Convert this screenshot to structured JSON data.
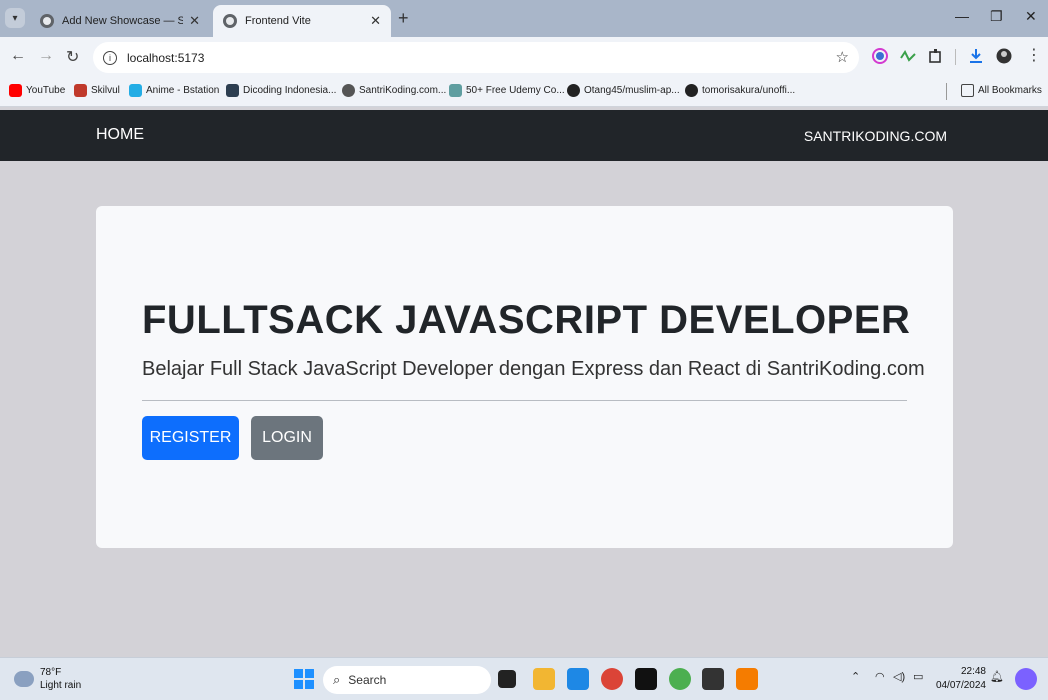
{
  "browser": {
    "tabs": [
      {
        "title": "Add New Showcase — SantriKo",
        "active": false
      },
      {
        "title": "Frontend Vite",
        "active": true
      }
    ],
    "address": "localhost:5173",
    "bookmarks": [
      {
        "label": "YouTube",
        "icon": "youtube-icon",
        "color": "#ff0000"
      },
      {
        "label": "Skilvul",
        "icon": "skilvul-icon",
        "color": "#c0392b"
      },
      {
        "label": "Anime - Bstation",
        "icon": "bstation-icon",
        "color": "#23ade5"
      },
      {
        "label": "Dicoding Indonesia...",
        "icon": "dicoding-icon",
        "color": "#2d3e50"
      },
      {
        "label": "SantriKoding.com...",
        "icon": "santrikoding-icon",
        "color": "#555555"
      },
      {
        "label": "50+ Free Udemy Co...",
        "icon": "udemy-icon",
        "color": "#5f9ea0"
      },
      {
        "label": "Otang45/muslim-ap...",
        "icon": "github-icon",
        "color": "#222222"
      },
      {
        "label": "tomorisakura/unoffi...",
        "icon": "github-icon",
        "color": "#222222"
      }
    ],
    "all_bookmarks": "All Bookmarks"
  },
  "navbar": {
    "home": "HOME",
    "brand": "SANTRIKODING.COM"
  },
  "hero": {
    "title": "FULLTSACK JAVASCRIPT DEVELOPER",
    "lead": "Belajar Full Stack JavaScript Developer dengan Express dan React di SantriKoding.com",
    "register": "REGISTER",
    "login": "LOGIN"
  },
  "taskbar": {
    "weather_temp": "78°F",
    "weather_desc": "Light rain",
    "search_placeholder": "Search",
    "time": "22:48",
    "date": "04/07/2024"
  },
  "colors": {
    "primary": "#0d6efd",
    "secondary": "#6c757d",
    "navbar": "#212529"
  }
}
